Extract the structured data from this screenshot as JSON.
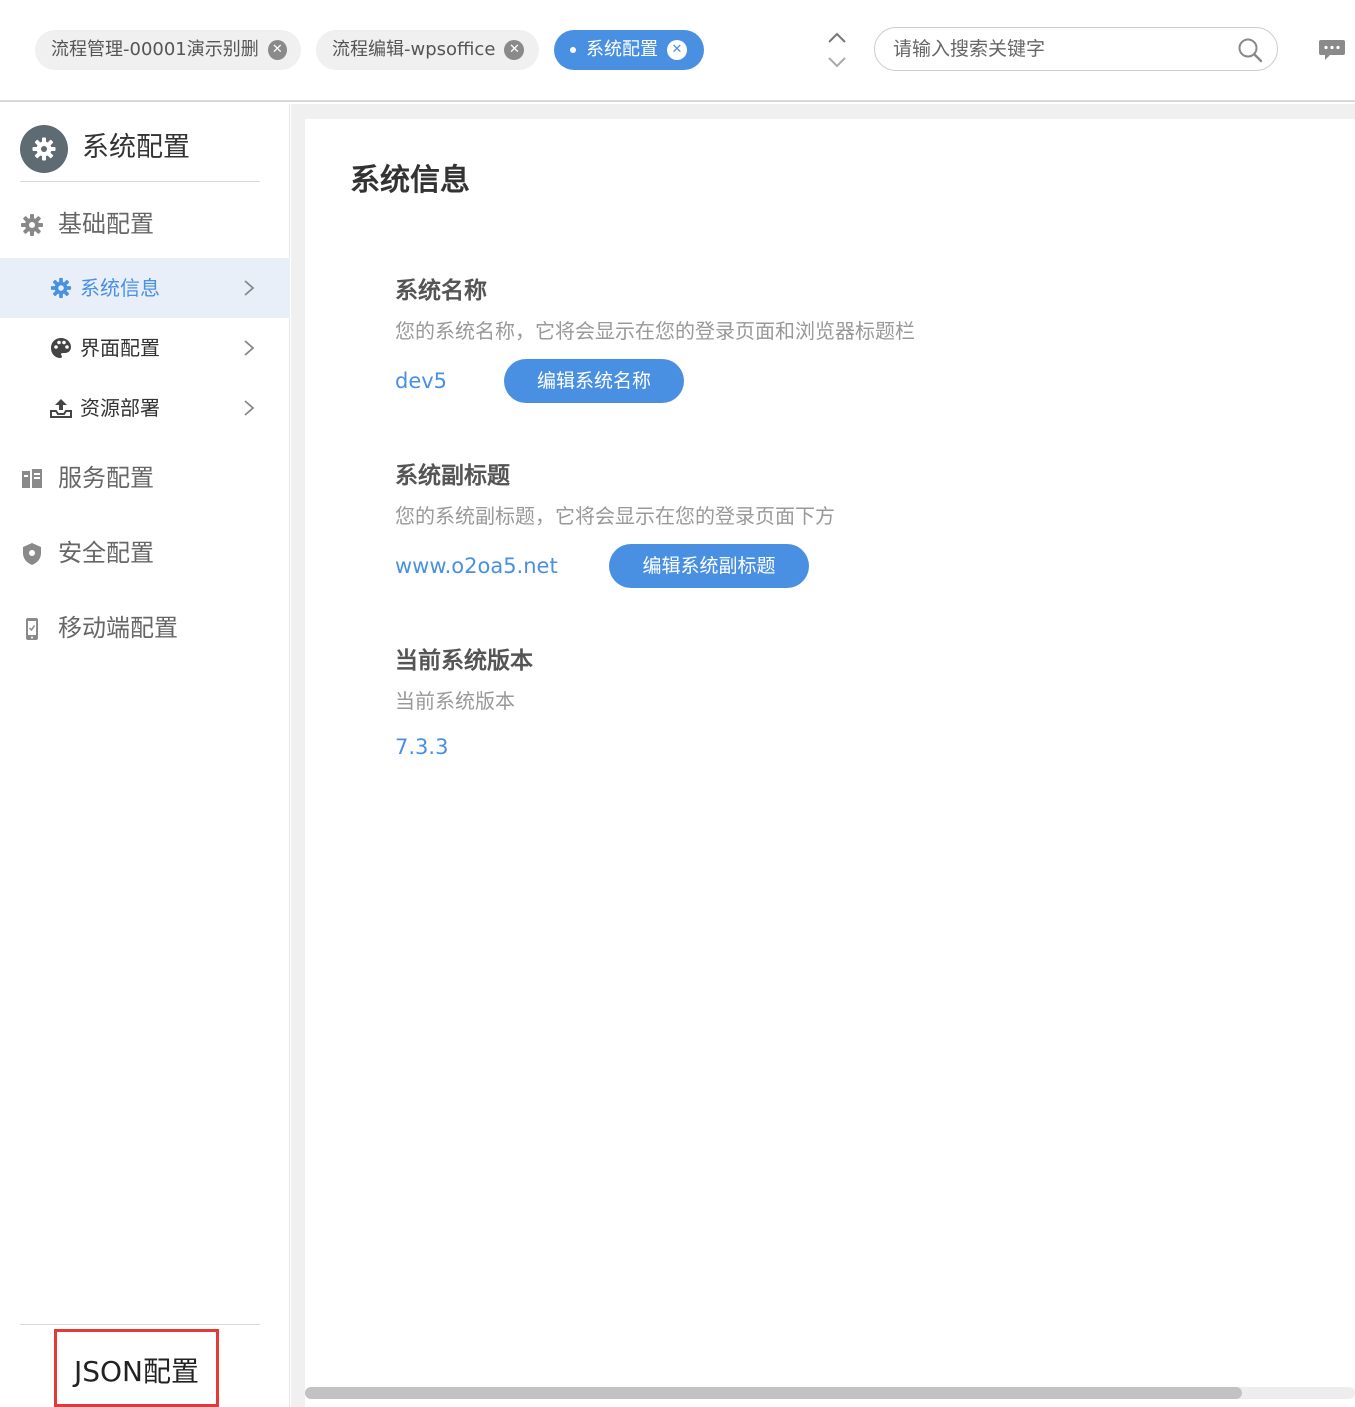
{
  "tabs": [
    {
      "label": "流程管理-00001演示别删",
      "close": "✕",
      "active": false
    },
    {
      "label": "流程编辑-wpsoffice",
      "close": "✕",
      "active": false
    },
    {
      "label": "系统配置",
      "close": "✕",
      "active": true
    }
  ],
  "search": {
    "placeholder": "请输入搜索关键字",
    "icon": "search-icon"
  },
  "sidebar": {
    "title": "系统配置",
    "groups": [
      {
        "label": "基础配置",
        "icon": "gear-icon"
      },
      {
        "label": "服务配置",
        "icon": "server-icon"
      },
      {
        "label": "安全配置",
        "icon": "shield-icon"
      },
      {
        "label": "移动端配置",
        "icon": "mobile-icon"
      }
    ],
    "subitems": [
      {
        "label": "系统信息",
        "icon": "gear-icon",
        "active": true
      },
      {
        "label": "界面配置",
        "icon": "palette-icon",
        "active": false
      },
      {
        "label": "资源部署",
        "icon": "upload-icon",
        "active": false
      }
    ],
    "json_button": "JSON配置"
  },
  "main": {
    "title": "系统信息",
    "sections": [
      {
        "title": "系统名称",
        "desc": "您的系统名称，它将会显示在您的登录页面和浏览器标题栏",
        "value": "dev5",
        "button": "编辑系统名称"
      },
      {
        "title": "系统副标题",
        "desc": "您的系统副标题，它将会显示在您的登录页面下方",
        "value": "www.o2oa5.net",
        "button": "编辑系统副标题"
      },
      {
        "title": "当前系统版本",
        "desc": "当前系统版本",
        "value": "7.3.3"
      }
    ]
  },
  "colors": {
    "accent": "#4a90e2",
    "highlight_border": "#e53935"
  }
}
